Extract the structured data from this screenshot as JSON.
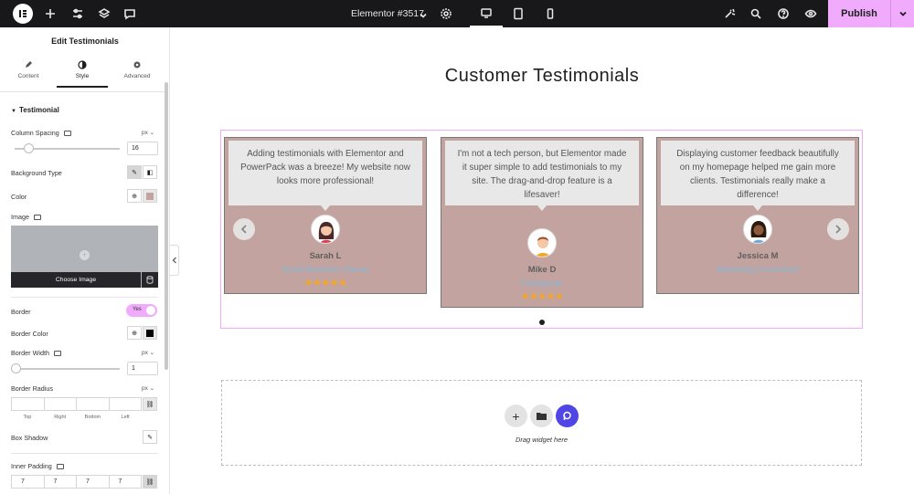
{
  "topbar": {
    "title": "Elementor #3517",
    "publish_label": "Publish"
  },
  "panel": {
    "title": "Edit Testimonials",
    "tabs": [
      {
        "label": "Content",
        "icon": "pencil-icon"
      },
      {
        "label": "Style",
        "icon": "contrast-icon"
      },
      {
        "label": "Advanced",
        "icon": "gear-icon"
      }
    ],
    "section_title": "Testimonial",
    "column_spacing": {
      "label": "Column Spacing",
      "unit": "px",
      "value": "16"
    },
    "background_type_label": "Background Type",
    "color_label": "Color",
    "image_label": "Image",
    "choose_image_label": "Choose Image",
    "border": {
      "label": "Border",
      "toggle_label": "Yes"
    },
    "border_color_label": "Border Color",
    "border_width": {
      "label": "Border Width",
      "unit": "px",
      "value": "1"
    },
    "border_radius": {
      "label": "Border Radius",
      "unit": "px",
      "sides": [
        "Top",
        "Right",
        "Bottom",
        "Left"
      ]
    },
    "box_shadow_label": "Box Shadow",
    "inner_padding": {
      "label": "Inner Padding",
      "values": [
        "7",
        "7",
        "7",
        "7"
      ]
    }
  },
  "canvas": {
    "heading": "Customer Testimonials",
    "testimonials": [
      {
        "text": "Adding testimonials with Elementor and PowerPack was a breeze! My website now looks more professional!",
        "name": "Sarah L",
        "position": "Small Business Owner",
        "stars": "★★★★★"
      },
      {
        "text": "I'm not a tech person, but Elementor made it super simple to add testimonials to my site. The drag-and-drop feature is a lifesaver!",
        "name": "Mike D",
        "position": "Freelancer",
        "stars": "★★★★★"
      },
      {
        "text": "Displaying customer feedback beautifully on my homepage helped me gain more clients. Testimonials really make a difference!",
        "name": "Jessica M",
        "position": "Marketing Consultant",
        "stars": "★★★★★"
      }
    ],
    "drag_widget_text": "Drag widget here"
  },
  "colors": {
    "accent": "#f0abfc",
    "card_bg": "#c3a39f",
    "star": "#f5a623",
    "position_text": "#85b8d9",
    "powerpack": "#5046e5"
  }
}
